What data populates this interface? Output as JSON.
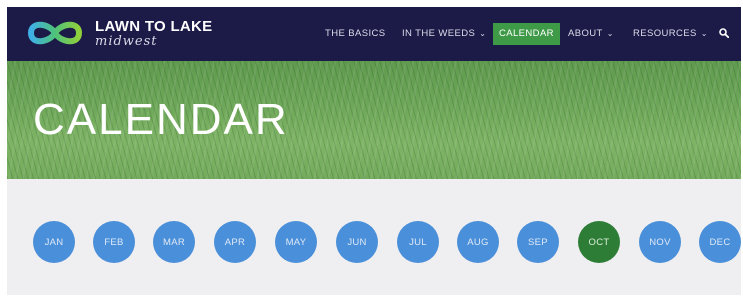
{
  "brand": {
    "name": "LAWN TO LAKE",
    "tagline": "midwest"
  },
  "nav": {
    "items": [
      {
        "label": "THE BASICS",
        "has_dropdown": false
      },
      {
        "label": "IN THE WEEDS",
        "has_dropdown": true
      },
      {
        "label": "CALENDAR",
        "has_dropdown": false,
        "active": true
      },
      {
        "label": "ABOUT",
        "has_dropdown": true
      },
      {
        "label": "RESOURCES",
        "has_dropdown": true
      }
    ],
    "dropdown_glyph": "⌄"
  },
  "hero": {
    "title": "CALENDAR"
  },
  "months": {
    "items": [
      "JAN",
      "FEB",
      "MAR",
      "APR",
      "MAY",
      "JUN",
      "JUL",
      "AUG",
      "SEP",
      "OCT",
      "NOV",
      "DEC"
    ],
    "selected": "OCT"
  },
  "colors": {
    "header_bg": "#1c1a47",
    "active_nav": "#3f9a48",
    "month_button": "#4a8fd9",
    "month_selected": "#2e7d36",
    "page_bg": "#efeff1"
  },
  "icons": {
    "logo": "infinity-logo-icon",
    "search": "search-icon",
    "dropdown": "chevron-down-icon"
  }
}
